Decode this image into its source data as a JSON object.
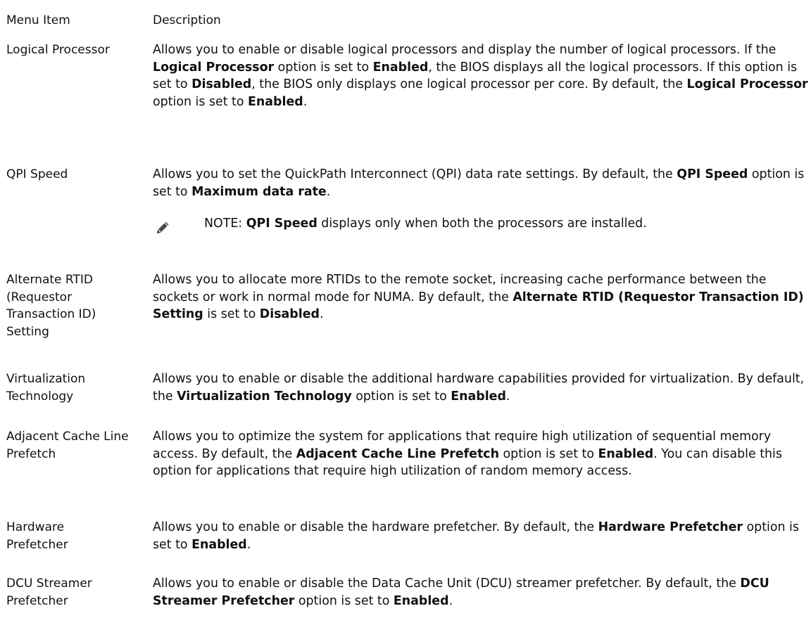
{
  "table": {
    "header": {
      "menu_item": "Menu Item",
      "description": "Description"
    },
    "rows": [
      {
        "name": "Logical Processor",
        "description": [
          {
            "t": "Allows you to enable or disable logical processors and display the number of logical processors. If the "
          },
          {
            "t": "Logical Processor",
            "b": true
          },
          {
            "t": " option is set to "
          },
          {
            "t": "Enabled",
            "b": true
          },
          {
            "t": ", the BIOS displays all the logical processors. If this option is set to "
          },
          {
            "t": "Disabled",
            "b": true
          },
          {
            "t": ", the BIOS only displays one logical processor per core. By default, the "
          },
          {
            "t": "Logical Processor",
            "b": true
          },
          {
            "t": " option is set to "
          },
          {
            "t": "Enabled",
            "b": true
          },
          {
            "t": "."
          }
        ]
      },
      {
        "name": "QPI Speed",
        "description": [
          {
            "t": "Allows you to set the QuickPath Interconnect (QPI) data rate settings. By default, the "
          },
          {
            "t": "QPI Speed",
            "b": true
          },
          {
            "t": " option is set to "
          },
          {
            "t": "Maximum data rate",
            "b": true
          },
          {
            "t": "."
          }
        ],
        "note": [
          {
            "t": "NOTE: "
          },
          {
            "t": "QPI Speed",
            "b": true
          },
          {
            "t": " displays only when both the processors are installed."
          }
        ]
      },
      {
        "name": "Alternate RTID (Requestor Transaction ID) Setting",
        "description": [
          {
            "t": "Allows you to allocate more RTIDs to the remote socket, increasing cache performance between the sockets or work in normal mode for NUMA. By default, the "
          },
          {
            "t": "Alternate RTID (Requestor Transaction ID) Setting",
            "b": true
          },
          {
            "t": " is set to "
          },
          {
            "t": "Disabled",
            "b": true
          },
          {
            "t": "."
          }
        ]
      },
      {
        "name": "Virtualization Technology",
        "description": [
          {
            "t": "Allows you to enable or disable the additional hardware capabilities provided for virtualization. By default, the "
          },
          {
            "t": "Virtualization Technology",
            "b": true
          },
          {
            "t": " option is set to "
          },
          {
            "t": "Enabled",
            "b": true
          },
          {
            "t": "."
          }
        ]
      },
      {
        "name": "Adjacent Cache Line Prefetch",
        "description": [
          {
            "t": "Allows you to optimize the system for applications that require high utilization of sequential memory access. By default, the "
          },
          {
            "t": "Adjacent Cache Line Prefetch",
            "b": true
          },
          {
            "t": " option is set to "
          },
          {
            "t": "Enabled",
            "b": true
          },
          {
            "t": ". You can disable this option for applications that require high utilization of random memory access."
          }
        ]
      },
      {
        "name": "Hardware Prefetcher",
        "description": [
          {
            "t": "Allows you to enable or disable the hardware prefetcher. By default, the "
          },
          {
            "t": "Hardware Prefetcher",
            "b": true
          },
          {
            "t": " option is set to "
          },
          {
            "t": "Enabled",
            "b": true
          },
          {
            "t": "."
          }
        ]
      },
      {
        "name": "DCU Streamer Prefetcher",
        "description": [
          {
            "t": "Allows you to enable or disable the Data Cache Unit (DCU) streamer prefetcher. By default, the "
          },
          {
            "t": "DCU Streamer Prefetcher",
            "b": true
          },
          {
            "t": " option is set to "
          },
          {
            "t": "Enabled",
            "b": true
          },
          {
            "t": "."
          }
        ]
      }
    ]
  },
  "icons": {
    "note": "pencil-note-icon"
  }
}
